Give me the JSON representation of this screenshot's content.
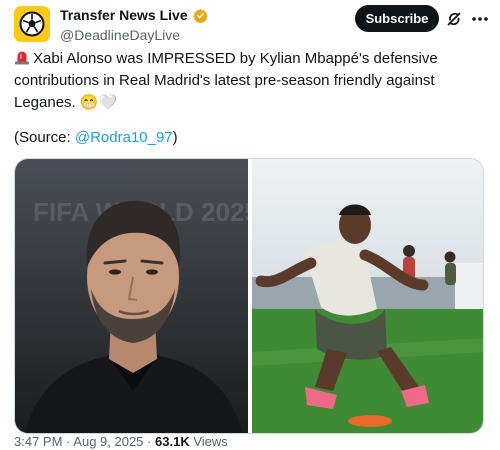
{
  "account": {
    "display_name": "Transfer News Live",
    "handle": "@DeadlineDayLive",
    "verified_badge_icon": "verified-badge-icon",
    "avatar_icon": "football-logo-icon"
  },
  "actions": {
    "subscribe_label": "Subscribe",
    "grok_icon": "grok-icon",
    "more_icon": "more-options-icon"
  },
  "tweet": {
    "siren_icon": "siren-emoji-icon",
    "body": "Xabi Alonso was IMPRESSED by Kylian Mbappé's defensive contributions in Real Madrid's latest pre-season friendly against Leganes.",
    "grin_emoji": "😁",
    "heart_emoji": "🤍",
    "source_prefix": "(Source: ",
    "source_mention": "@Rodra10_97",
    "source_suffix": ")"
  },
  "media": {
    "left_image": "xabi-alonso-portrait-photo",
    "right_image": "kylian-mbappe-training-photo",
    "background_text": "FIFA WORLD 2025"
  },
  "meta": {
    "time": "3:47 PM",
    "separator": "·",
    "date": "Aug 9, 2025",
    "views_count": "63.1K",
    "views_label": "Views"
  },
  "colors": {
    "text": "#0f1419",
    "secondary": "#536471",
    "link": "#1d9bf0",
    "verified": "#e8a813",
    "avatar_bg": "#ffc91a"
  }
}
